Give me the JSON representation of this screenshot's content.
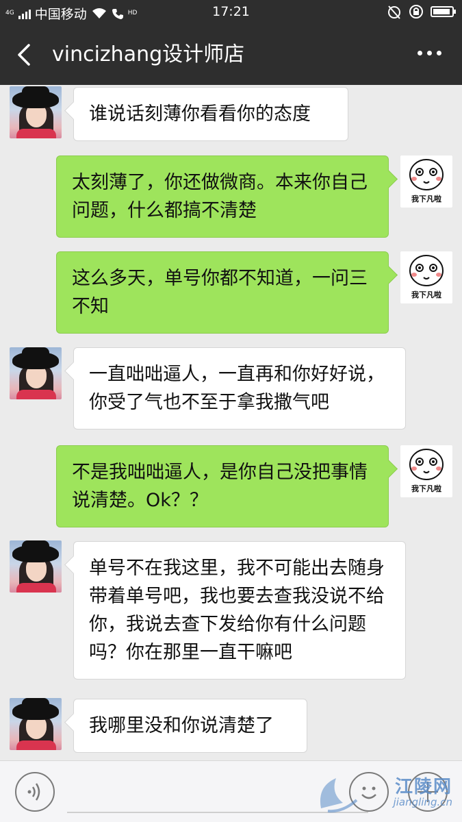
{
  "status_bar": {
    "network_label": "4G",
    "carrier": "中国移动",
    "hd_label": "HD",
    "time": "17:21",
    "battery_level": 0.8,
    "icons": [
      "signal-icon",
      "wifi-icon",
      "hd-call-icon",
      "alarm-off-icon",
      "rotation-lock-icon",
      "battery-icon"
    ]
  },
  "header": {
    "title": "vincizhang设计师店",
    "back_icon": "chevron-left-icon",
    "more_icon": "more-dots-icon"
  },
  "sticker_caption": "我下凡啦",
  "messages": [
    {
      "side": "left",
      "text": "谁说话刻薄你看看你的态度"
    },
    {
      "side": "right",
      "text": "太刻薄了，你还做微商。本来你自己问题，什么都搞不清楚"
    },
    {
      "side": "right",
      "text": "这么多天，单号你都不知道，一问三不知"
    },
    {
      "side": "left",
      "text": "一直咄咄逼人，一直再和你好好说，你受了气也不至于拿我撒气吧"
    },
    {
      "side": "right",
      "text": "不是我咄咄逼人，是你自己没把事情说清楚。Ok？？"
    },
    {
      "side": "left",
      "text": "单号不在我这里，我不可能出去随身带着单号吧，我也要去查我没说不给你，我说去查下发给你有什么问题吗？你在那里一直干嘛吧"
    },
    {
      "side": "left",
      "text": "我哪里没和你说清楚了"
    }
  ],
  "input_bar": {
    "voice_icon": "voice-icon",
    "emoji_icon": "emoji-icon",
    "plus_icon": "plus-icon"
  },
  "watermark": {
    "name": "江陵网",
    "url": "jiangling.cn"
  }
}
